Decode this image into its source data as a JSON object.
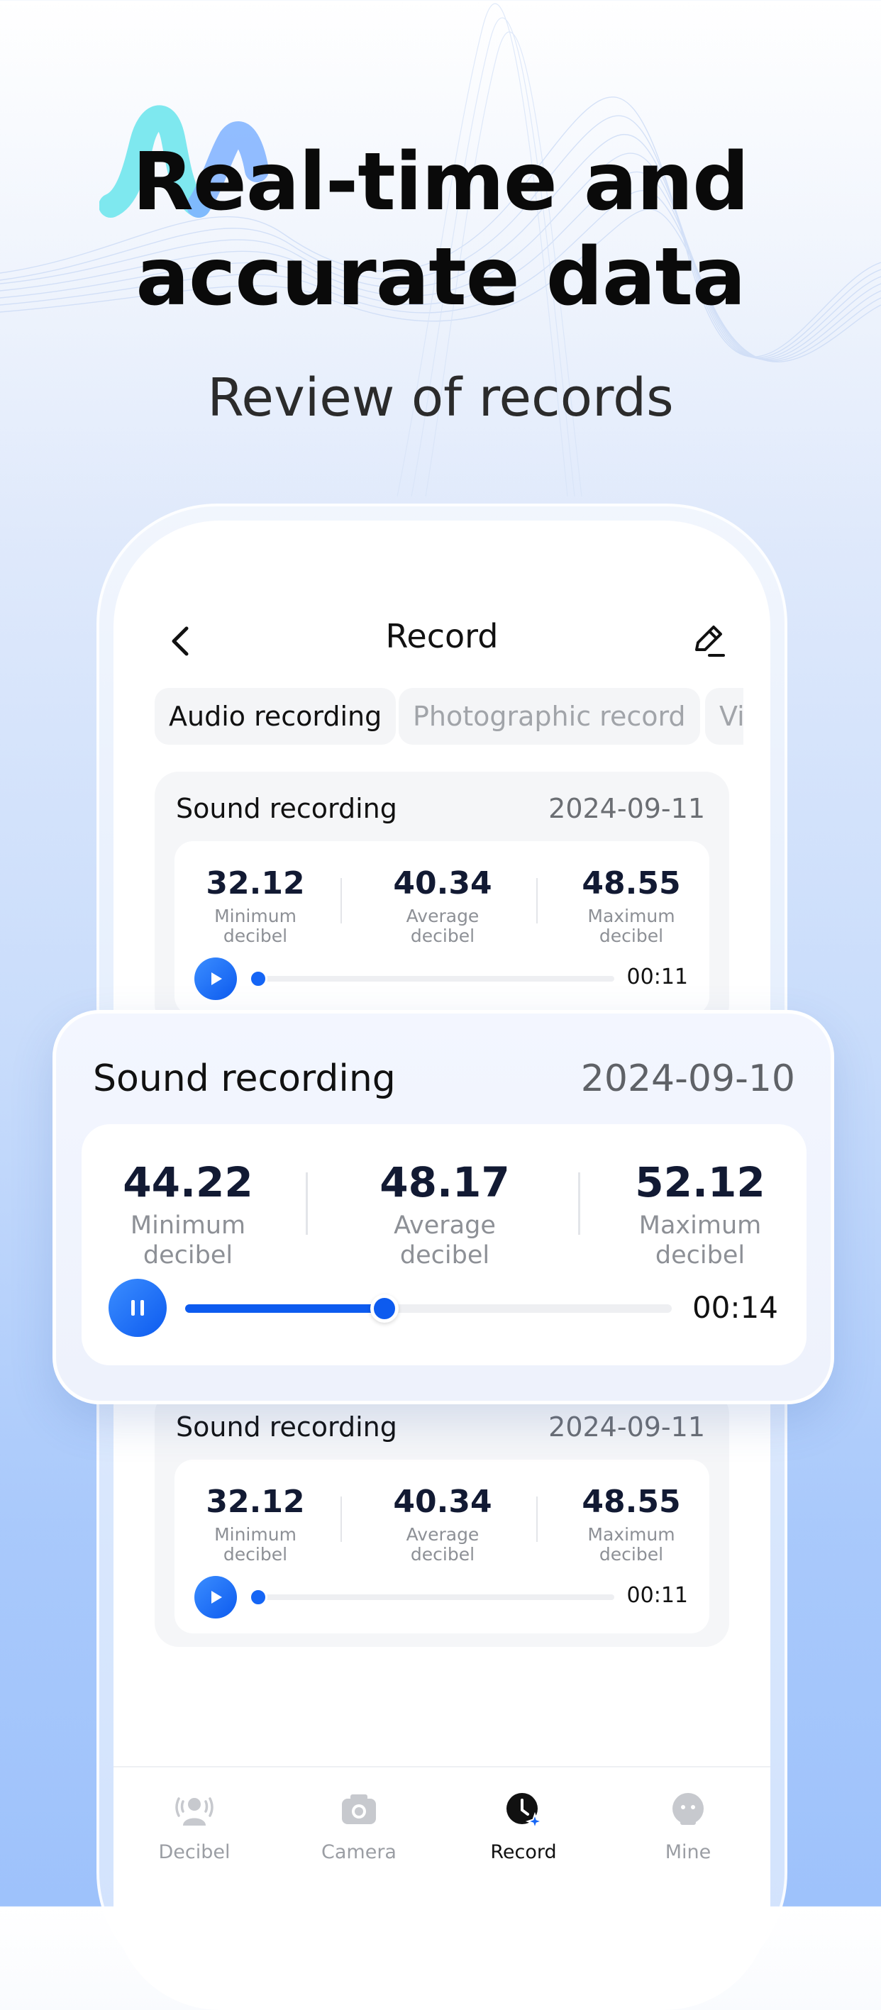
{
  "hero": {
    "title_line1": "Real-time and",
    "title_line2": "accurate data",
    "subtitle": "Review of records"
  },
  "header": {
    "title": "Record"
  },
  "tabs": [
    {
      "label": "Audio recording",
      "active": true
    },
    {
      "label": "Photographic record",
      "active": false
    },
    {
      "label": "Video record",
      "active": false
    }
  ],
  "records": [
    {
      "title": "Sound recording",
      "date": "2024-09-11",
      "min": "32.12",
      "avg": "40.34",
      "max": "48.55",
      "min_label": "Minimum decibel",
      "avg_label": "Average decibel",
      "max_label": "Maximum decibel",
      "duration": "00:11",
      "progress": 0
    },
    {
      "title": "Sound recording",
      "date": "2024-09-11",
      "min": "32.12",
      "avg": "40.34",
      "max": "48.55",
      "min_label": "Minimum decibel",
      "avg_label": "Average decibel",
      "max_label": "Maximum decibel",
      "duration": "00:11",
      "progress": 0
    }
  ],
  "focused_record": {
    "title": "Sound recording",
    "date": "2024-09-10",
    "min": "44.22",
    "avg": "48.17",
    "max": "52.12",
    "min_label": "Minimum decibel",
    "avg_label": "Average decibel",
    "max_label": "Maximum decibel",
    "duration": "00:14",
    "progress": 0.41,
    "state": "playing"
  },
  "tabbar": [
    {
      "label": "Decibel",
      "icon": "decibel-icon",
      "active": false
    },
    {
      "label": "Camera",
      "icon": "camera-icon",
      "active": false
    },
    {
      "label": "Record",
      "icon": "record-clock-icon",
      "active": true
    },
    {
      "label": "Mine",
      "icon": "mine-face-icon",
      "active": false
    }
  ],
  "colors": {
    "accent": "#0d5bef",
    "accent_light": "#3b8dff",
    "logo_cyan": "#7ee8ef",
    "logo_blue": "#7fb2ff"
  }
}
